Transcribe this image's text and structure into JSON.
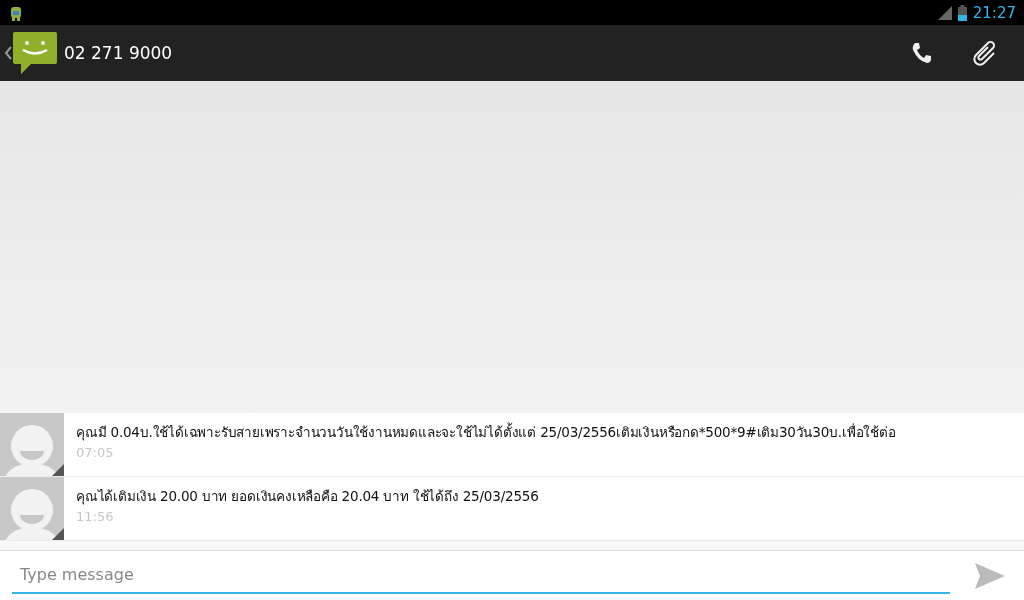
{
  "status_bar": {
    "time": "21:27"
  },
  "action_bar": {
    "title": "02 271 9000"
  },
  "messages": [
    {
      "text": "คุณมี 0.04บ.ใช้ได้เฉพาะรับสายเพราะจำนวนวันใช้งานหมดและจะใช้ไม่ได้ตั้งแต่ 25/03/2556เติมเงินหรือกด*500*9#เติม30วัน30บ.เพื่อใช้ต่อ",
      "time": "07:05"
    },
    {
      "text": "คุณได้เติมเงิน 20.00 บาท ยอดเงินคงเหลือคือ 20.04 บาท ใช้ได้ถึง 25/03/2556",
      "time": "11:56"
    }
  ],
  "composer": {
    "placeholder": "Type message"
  }
}
